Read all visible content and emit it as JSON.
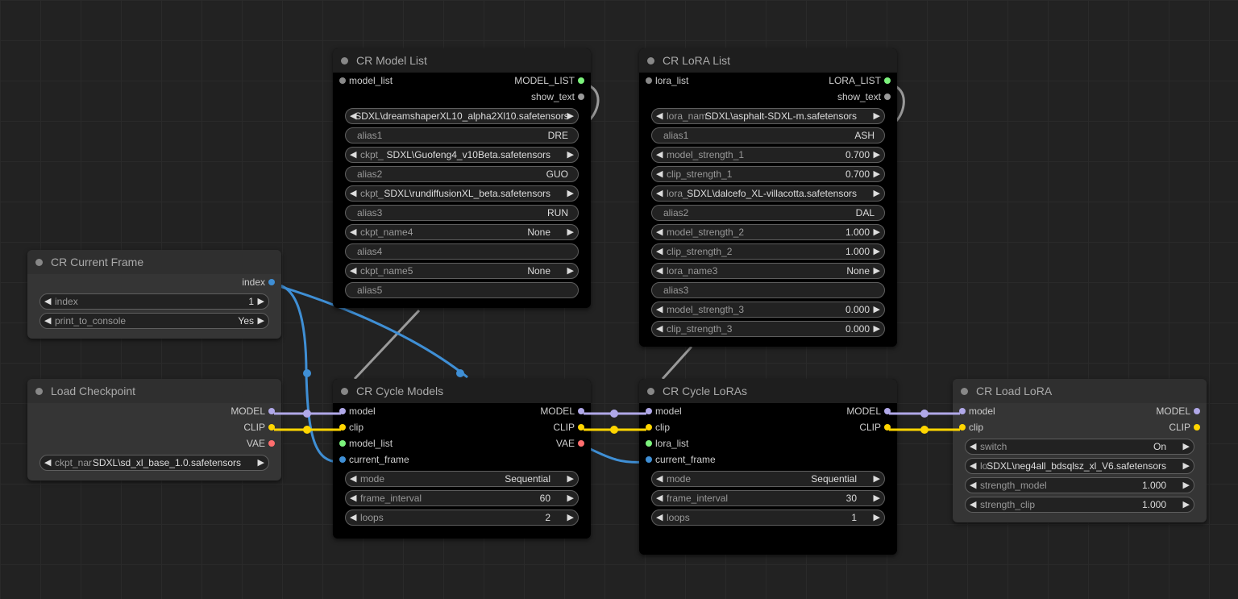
{
  "colors": {
    "model": "#b0a8e8",
    "clip": "#ffd500",
    "vae": "#ff6e6e",
    "list": "#7cf27c",
    "index": "#3f8fd5",
    "gray": "#999999"
  },
  "nodes": {
    "model_list": {
      "title": "CR Model List",
      "inputs": [
        "model_list"
      ],
      "outputs": [
        "MODEL_LIST",
        "show_text"
      ],
      "widgets": [
        {
          "label": "",
          "value": "SDXL\\dreamshaperXL10_alpha2Xl10.safetensors"
        },
        {
          "label": "alias1",
          "value": "DRE"
        },
        {
          "label": "ckpt_",
          "value": "SDXL\\Guofeng4_v10Beta.safetensors"
        },
        {
          "label": "alias2",
          "value": "GUO"
        },
        {
          "label": "ckpt_",
          "value": "SDXL\\rundiffusionXL_beta.safetensors"
        },
        {
          "label": "alias3",
          "value": "RUN"
        },
        {
          "label": "ckpt_name4",
          "value": "None"
        },
        {
          "label": "alias4",
          "value": ""
        },
        {
          "label": "ckpt_name5",
          "value": "None"
        },
        {
          "label": "alias5",
          "value": ""
        }
      ]
    },
    "lora_list": {
      "title": "CR LoRA List",
      "inputs": [
        "lora_list"
      ],
      "outputs": [
        "LORA_LIST",
        "show_text"
      ],
      "widgets": [
        {
          "label": "lora_nam",
          "value": "SDXL\\asphalt-SDXL-m.safetensors"
        },
        {
          "label": "alias1",
          "value": "ASH"
        },
        {
          "label": "model_strength_1",
          "value": "0.700"
        },
        {
          "label": "clip_strength_1",
          "value": "0.700"
        },
        {
          "label": "lora_",
          "value": "SDXL\\dalcefo_XL-villacotta.safetensors"
        },
        {
          "label": "alias2",
          "value": "DAL"
        },
        {
          "label": "model_strength_2",
          "value": "1.000"
        },
        {
          "label": "clip_strength_2",
          "value": "1.000"
        },
        {
          "label": "lora_name3",
          "value": "None"
        },
        {
          "label": "alias3",
          "value": ""
        },
        {
          "label": "model_strength_3",
          "value": "0.000"
        },
        {
          "label": "clip_strength_3",
          "value": "0.000"
        }
      ]
    },
    "current_frame": {
      "title": "CR Current Frame",
      "outputs": [
        "index"
      ],
      "widgets": [
        {
          "label": "index",
          "value": "1"
        },
        {
          "label": "print_to_console",
          "value": "Yes"
        }
      ]
    },
    "load_checkpoint": {
      "title": "Load Checkpoint",
      "outputs": [
        "MODEL",
        "CLIP",
        "VAE"
      ],
      "widgets": [
        {
          "label": "ckpt_nar",
          "value": "SDXL\\sd_xl_base_1.0.safetensors"
        }
      ]
    },
    "cycle_models": {
      "title": "CR Cycle Models",
      "inputs": [
        "model",
        "clip",
        "model_list",
        "current_frame"
      ],
      "outputs": [
        "MODEL",
        "CLIP",
        "VAE"
      ],
      "widgets": [
        {
          "label": "mode",
          "value": "Sequential"
        },
        {
          "label": "frame_interval",
          "value": "60"
        },
        {
          "label": "loops",
          "value": "2"
        }
      ]
    },
    "cycle_loras": {
      "title": "CR Cycle LoRAs",
      "inputs": [
        "model",
        "clip",
        "lora_list",
        "current_frame"
      ],
      "outputs": [
        "MODEL",
        "CLIP"
      ],
      "widgets": [
        {
          "label": "mode",
          "value": "Sequential"
        },
        {
          "label": "frame_interval",
          "value": "30"
        },
        {
          "label": "loops",
          "value": "1"
        }
      ]
    },
    "load_lora": {
      "title": "CR Load LoRA",
      "inputs": [
        "model",
        "clip"
      ],
      "outputs": [
        "MODEL",
        "CLIP"
      ],
      "widgets": [
        {
          "label": "switch",
          "value": "On"
        },
        {
          "label": "lo",
          "value": "SDXL\\neg4all_bdsqlsz_xl_V6.safetensors"
        },
        {
          "label": "strength_model",
          "value": "1.000"
        },
        {
          "label": "strength_clip",
          "value": "1.000"
        }
      ]
    }
  }
}
